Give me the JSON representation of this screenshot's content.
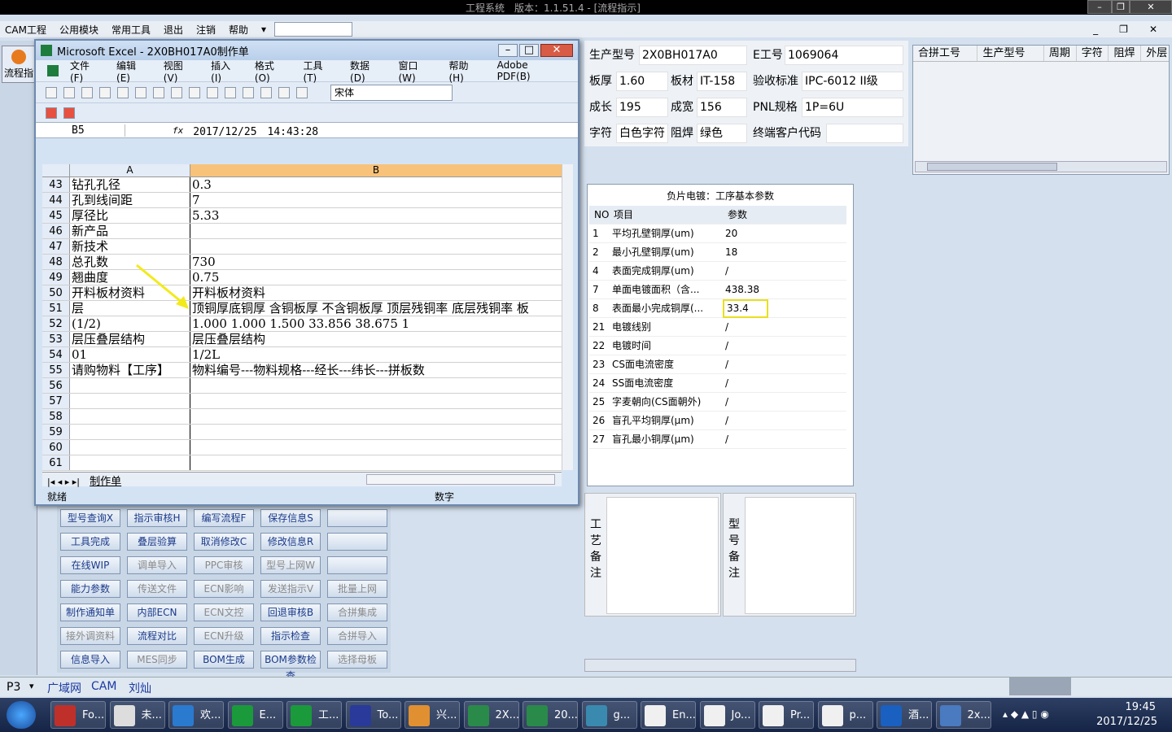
{
  "app_title": "工程系统　版本：1.1.51.4 - [流程指示]",
  "menu": [
    "CAM工程",
    "公用模块",
    "常用工具",
    "退出",
    "注销",
    "帮助"
  ],
  "left_tab": "流程指",
  "excel": {
    "title": "Microsoft Excel - 2X0BH017A0制作单",
    "menu": [
      "文件(F)",
      "编辑(E)",
      "视图(V)",
      "插入(I)",
      "格式(O)",
      "工具(T)",
      "数据(D)",
      "窗口(W)",
      "帮助(H)",
      "Adobe PDF(B)"
    ],
    "font_box": "宋体",
    "cell_ref": "B5",
    "fx": "fx",
    "formula": "2017/12/25　14:43:28",
    "col_a": "A",
    "col_b": "B",
    "rows": [
      {
        "n": "43",
        "a": "钻孔孔径",
        "b": "0.3"
      },
      {
        "n": "44",
        "a": "孔到线间距",
        "b": "7"
      },
      {
        "n": "45",
        "a": "厚径比",
        "b": "5.33"
      },
      {
        "n": "46",
        "a": "新产品",
        "b": ""
      },
      {
        "n": "47",
        "a": "新技术",
        "b": ""
      },
      {
        "n": "48",
        "a": "总孔数",
        "b": "730"
      },
      {
        "n": "49",
        "a": "翘曲度",
        "b": "0.75"
      },
      {
        "n": "50",
        "a": "开料板材资料",
        "b": "开料板材资料"
      },
      {
        "n": "51",
        "a": "层",
        "b": "顶铜厚底铜厚 含铜板厚 不含铜板厚 顶层残铜率 底层残铜率 板"
      },
      {
        "n": "52",
        "a": "(1/2)",
        "b": "1.000  1.000   1.500          33.856    38.675    1"
      },
      {
        "n": "53",
        "a": "层压叠层结构",
        "b": "层压叠层结构"
      },
      {
        "n": "54",
        "a": "01",
        "b": "1/2L"
      },
      {
        "n": "55",
        "a": "请购物料【工序】",
        "b": "物料编号---物料规格---经长---纬长---拼板数"
      },
      {
        "n": "56",
        "a": "",
        "b": ""
      },
      {
        "n": "57",
        "a": "",
        "b": ""
      },
      {
        "n": "58",
        "a": "",
        "b": ""
      },
      {
        "n": "59",
        "a": "",
        "b": ""
      },
      {
        "n": "60",
        "a": "",
        "b": ""
      },
      {
        "n": "61",
        "a": "",
        "b": ""
      }
    ],
    "sheet_tab": "制作单",
    "status_left": "就绪",
    "status_num": "数字"
  },
  "info": {
    "model_label": "生产型号",
    "model": "2X0BH017A0",
    "eno_label": "E工号",
    "eno": "1069064",
    "thick_label": "板厚",
    "thick": "1.60",
    "mat_label": "板材",
    "mat": "IT-158",
    "std_label": "验收标准",
    "std": "IPC-6012 II级",
    "len_label": "成长",
    "len": "195",
    "wid_label": "成宽",
    "wid": "156",
    "pnl_label": "PNL规格",
    "pnl": "1P=6U",
    "char_label": "字符",
    "char": "白色字符",
    "mask_label": "阻焊",
    "mask": "绿色",
    "cust_label": "终端客户代码",
    "cust": ""
  },
  "right_grid_headers": [
    "合拼工号",
    "生产型号",
    "周期",
    "字符",
    "阻焊",
    "外层"
  ],
  "params": {
    "title": "负片电镀：工序基本参数",
    "h_no": "NO",
    "h_item": "项目",
    "h_val": "参数",
    "rows": [
      {
        "no": "1",
        "item": "平均孔壁铜厚(um)",
        "val": "20"
      },
      {
        "no": "2",
        "item": "最小孔壁铜厚(um)",
        "val": "18"
      },
      {
        "no": "4",
        "item": "表面完成铜厚(um)",
        "val": "/"
      },
      {
        "no": "7",
        "item": "单面电镀面积（含...",
        "val": "438.38"
      },
      {
        "no": "8",
        "item": "表面最小完成铜厚(...",
        "val": "33.4"
      },
      {
        "no": "21",
        "item": "电镀线别",
        "val": "/"
      },
      {
        "no": "22",
        "item": "电镀时间",
        "val": "/"
      },
      {
        "no": "23",
        "item": "CS面电流密度",
        "val": "/"
      },
      {
        "no": "24",
        "item": "SS面电流密度",
        "val": "/"
      },
      {
        "no": "25",
        "item": "字麦朝向(CS面朝外)",
        "val": "/"
      },
      {
        "no": "26",
        "item": "盲孔平均铜厚(μm)",
        "val": "/"
      },
      {
        "no": "27",
        "item": "盲孔最小铜厚(μm)",
        "val": "/"
      }
    ]
  },
  "memo": {
    "craft": "工艺备注",
    "model": "型号备注"
  },
  "buttons": [
    {
      "label": "型号查询X",
      "en": true
    },
    {
      "label": "指示审核H",
      "en": true
    },
    {
      "label": "编写流程F",
      "en": true
    },
    {
      "label": "保存信息S",
      "en": true
    },
    {
      "label": "",
      "en": true
    },
    {
      "label": "工具完成",
      "en": true
    },
    {
      "label": "叠层验算",
      "en": true
    },
    {
      "label": "取消修改C",
      "en": true
    },
    {
      "label": "修改信息R",
      "en": true
    },
    {
      "label": "",
      "en": true
    },
    {
      "label": "在线WIP",
      "en": true
    },
    {
      "label": "调单导入",
      "en": false
    },
    {
      "label": "PPC审核",
      "en": false
    },
    {
      "label": "型号上网W",
      "en": false
    },
    {
      "label": "",
      "en": true
    },
    {
      "label": "能力参数",
      "en": true
    },
    {
      "label": "传送文件",
      "en": false
    },
    {
      "label": "ECN影响",
      "en": false
    },
    {
      "label": "发送指示V",
      "en": false
    },
    {
      "label": "批量上网",
      "en": false
    },
    {
      "label": "制作通知单",
      "en": true
    },
    {
      "label": "内部ECN",
      "en": true
    },
    {
      "label": "ECN文控",
      "en": false
    },
    {
      "label": "回退审核B",
      "en": true
    },
    {
      "label": "合拼集成",
      "en": false
    },
    {
      "label": "接外调资料",
      "en": false
    },
    {
      "label": "流程对比",
      "en": true
    },
    {
      "label": "ECN升级",
      "en": false
    },
    {
      "label": "指示检查",
      "en": true
    },
    {
      "label": "合拼导入",
      "en": false
    },
    {
      "label": "信息导入",
      "en": true
    },
    {
      "label": "MES同步",
      "en": false
    },
    {
      "label": "BOM生成",
      "en": true
    },
    {
      "label": "BOM参数检查",
      "en": true
    },
    {
      "label": "选择母板",
      "en": false
    }
  ],
  "bottom": {
    "combo": "P3",
    "tabs": [
      "广域网",
      "CAM",
      "刘灿"
    ]
  },
  "taskbar": {
    "items": [
      "Fo...",
      "未...",
      "欢...",
      "E...",
      "工...",
      "To...",
      "兴...",
      "2X...",
      "20...",
      "g...",
      "En...",
      "Jo...",
      "Pr...",
      "p...",
      "酒...",
      "2x..."
    ],
    "time": "19:45",
    "date": "2017/12/25"
  }
}
